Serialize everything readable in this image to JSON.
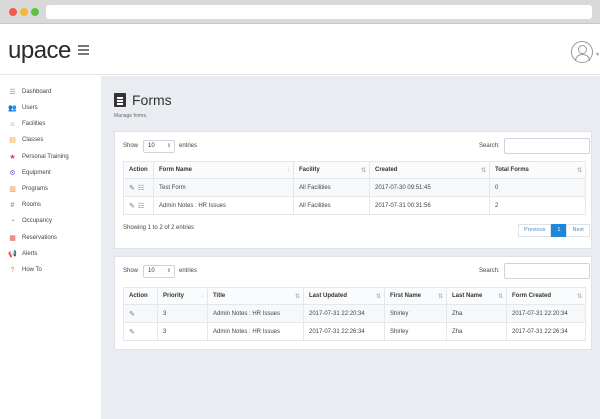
{
  "app": {
    "logo_text": "upace"
  },
  "sidebar": {
    "items": [
      {
        "label": "Dashboard",
        "icon": "grid-icon",
        "glyph": "☰",
        "color": "#6b8fb3"
      },
      {
        "label": "Users",
        "icon": "users-icon",
        "glyph": "👥",
        "color": "#333333"
      },
      {
        "label": "Facilities",
        "icon": "building-icon",
        "glyph": "⌂",
        "color": "#e0524f"
      },
      {
        "label": "Classes",
        "icon": "classes-icon",
        "glyph": "▤",
        "color": "#e8a33a"
      },
      {
        "label": "Personal Training",
        "icon": "star-icon",
        "glyph": "★",
        "color": "#d9414a"
      },
      {
        "label": "Equipment",
        "icon": "equipment-icon",
        "glyph": "⚙",
        "color": "#7a5ccf"
      },
      {
        "label": "Programs",
        "icon": "programs-icon",
        "glyph": "▥",
        "color": "#e8883a"
      },
      {
        "label": "Rooms",
        "icon": "hash-icon",
        "glyph": "#",
        "color": "#36a852"
      },
      {
        "label": "Occupancy",
        "icon": "occupancy-icon",
        "glyph": "◔",
        "color": "#2ea3c8"
      },
      {
        "label": "Reservations",
        "icon": "calendar-icon",
        "glyph": "▦",
        "color": "#e0524f"
      },
      {
        "label": "Alerts",
        "icon": "megaphone-icon",
        "glyph": "📢",
        "color": "#3a8fd8"
      },
      {
        "label": "How To",
        "icon": "help-icon",
        "glyph": "?",
        "color": "#e8883a"
      }
    ]
  },
  "page": {
    "title": "Forms",
    "subtitle": "Manage forms."
  },
  "forms_table": {
    "show_label": "Show",
    "entries_value": "10",
    "entries_label": "entries",
    "search_label": "Search:",
    "columns": [
      "Action",
      "Form Name",
      "Facility",
      "Created",
      "Total Forms"
    ],
    "rows": [
      {
        "name": "Test Form",
        "facility": "All Facilities",
        "created": "2017-07-30 09:51:45",
        "total": "0"
      },
      {
        "name": "Admin Notes : HR Issues",
        "facility": "All Facilities",
        "created": "2017-07-31 00:31:56",
        "total": "2"
      }
    ],
    "info": "Showing 1 to 2 of 2 entries",
    "pager": {
      "prev": "Previous",
      "page": "1",
      "next": "Next"
    }
  },
  "submissions_table": {
    "show_label": "Show",
    "entries_value": "10",
    "entries_label": "entries",
    "search_label": "Search:",
    "columns": [
      "Action",
      "Priority",
      "Title",
      "Last Updated",
      "First Name",
      "Last Name",
      "Form Created"
    ],
    "rows": [
      {
        "priority": "3",
        "title": "Admin Notes : HR Issues",
        "updated": "2017-07-31 22:20:34",
        "first": "Shirley",
        "last": "Zha",
        "created": "2017-07-31 22:20:34"
      },
      {
        "priority": "3",
        "title": "Admin Notes : HR Issues",
        "updated": "2017-07-31 22:26:34",
        "first": "Shirley",
        "last": "Zha",
        "created": "2017-07-31 22:26:34"
      }
    ]
  }
}
